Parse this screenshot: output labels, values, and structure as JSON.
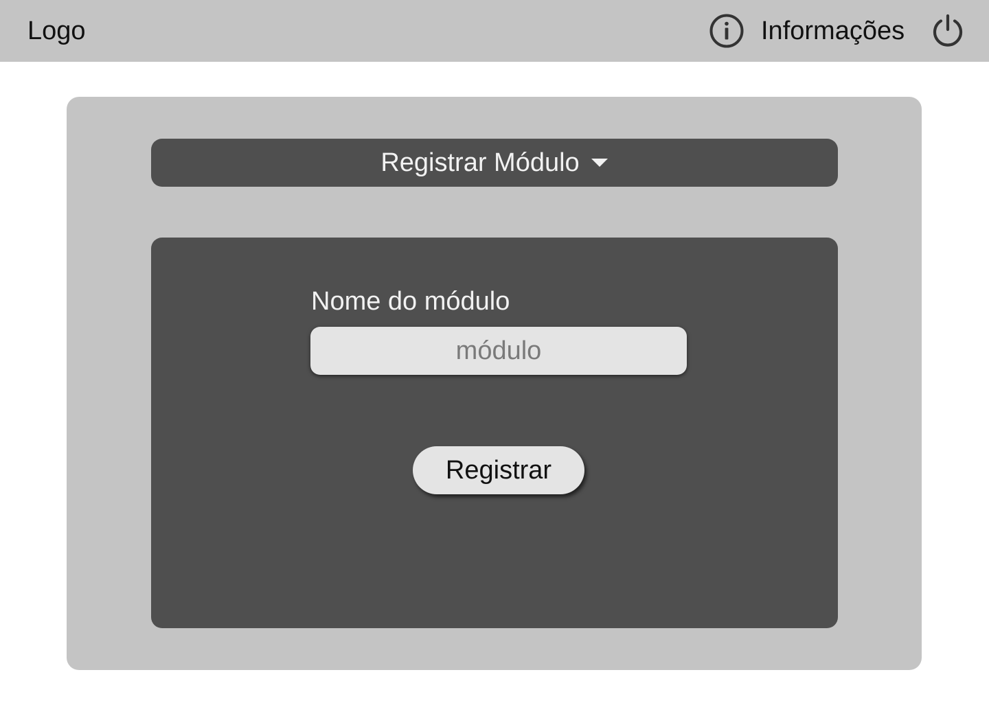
{
  "header": {
    "logo_text": "Logo",
    "info_label": "Informações",
    "info_icon": "info-icon",
    "power_icon": "power-icon"
  },
  "module_menu": {
    "selected_label": "Registrar Módulo",
    "caret_icon": "caret-down-icon"
  },
  "form": {
    "field_label": "Nome do módulo",
    "input_value": "",
    "input_placeholder": "módulo",
    "submit_label": "Registrar"
  },
  "colors": {
    "bar_background": "#c4c4c4",
    "panel_dark": "#4f4f4f",
    "input_background": "#e4e4e4"
  }
}
